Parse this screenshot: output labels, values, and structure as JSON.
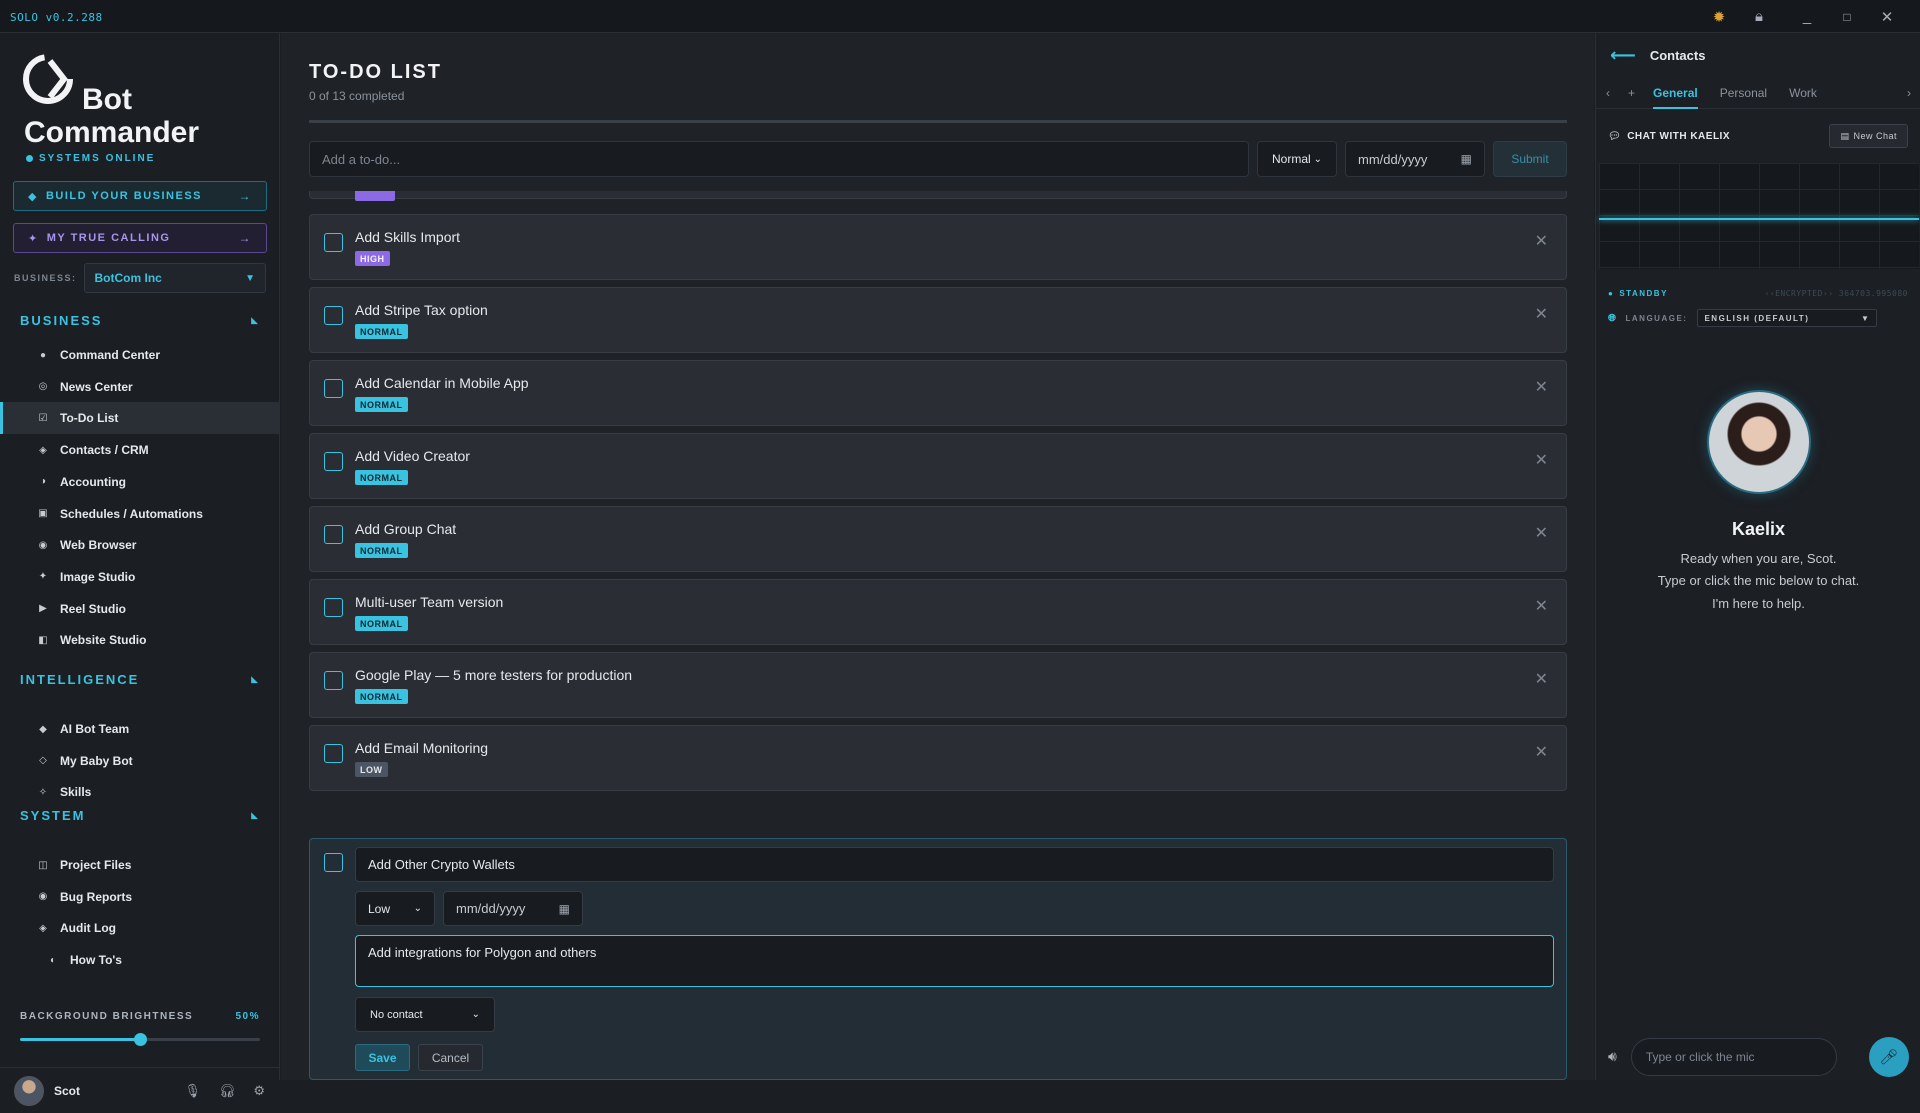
{
  "app": {
    "version": "SOLO  v0.2.288"
  },
  "brand": {
    "line1": "Bot",
    "line2": "Commander",
    "status": "SYSTEMS ONLINE"
  },
  "sidebar": {
    "build_btn": "BUILD YOUR BUSINESS",
    "calling_btn": "MY TRUE CALLING",
    "arrow": "→",
    "business_label": "BUSINESS:",
    "business_value": "BotCom Inc",
    "sections": {
      "business": "BUSINESS",
      "intelligence": "INTELLIGENCE",
      "system": "SYSTEM"
    },
    "business_items": [
      "Command Center",
      "News Center",
      "To-Do List",
      "Contacts / CRM",
      "Accounting",
      "Schedules / Automations",
      "Web Browser",
      "Image Studio",
      "Reel Studio",
      "Website Studio"
    ],
    "intelligence_items": [
      "AI Bot Team",
      "My Baby Bot",
      "Skills"
    ],
    "system_items": [
      "Project Files",
      "Bug Reports",
      "Audit Log"
    ],
    "howto": "How To's",
    "brightness_label": "BACKGROUND BRIGHTNESS",
    "brightness_pct": "50%",
    "brightness_value": 0.5,
    "user": "Scot"
  },
  "todo": {
    "title": "TO-DO LIST",
    "subtitle": "0 of 13 completed",
    "progress": 0,
    "add_placeholder": "Add a to-do...",
    "priority": "Normal",
    "date_placeholder": "mm/dd/yyyy",
    "submit": "Submit",
    "items": [
      {
        "text": "Add Skills Import",
        "tag": "HIGH",
        "cls": "high"
      },
      {
        "text": "Add Stripe Tax option",
        "tag": "NORMAL",
        "cls": "normal"
      },
      {
        "text": "Add Calendar in Mobile App",
        "tag": "NORMAL",
        "cls": "normal"
      },
      {
        "text": "Add Video Creator",
        "tag": "NORMAL",
        "cls": "normal"
      },
      {
        "text": "Add Group Chat",
        "tag": "NORMAL",
        "cls": "normal"
      },
      {
        "text": "Multi-user Team version",
        "tag": "NORMAL",
        "cls": "normal"
      },
      {
        "text": "Google Play — 5 more testers for production",
        "tag": "NORMAL",
        "cls": "normal"
      },
      {
        "text": "Add Email Monitoring",
        "tag": "LOW",
        "cls": "low"
      }
    ],
    "edit": {
      "title": "Add Other Crypto Wallets",
      "priority": "Low",
      "date": "mm/dd/yyyy",
      "notes": "Add integrations for Polygon and others",
      "contact": "No contact",
      "save": "Save",
      "cancel": "Cancel"
    }
  },
  "panel": {
    "title": "Contacts",
    "tabs": [
      "General",
      "Personal",
      "Work"
    ],
    "chat_title": "CHAT WITH KAELIX",
    "new_chat": "New Chat",
    "standby": "STANDBY",
    "encrypted": "‹‹ENCRYPTED›› 364703.995080",
    "language_label": "LANGUAGE:",
    "language_value": "ENGLISH (DEFAULT)",
    "name": "Kaelix",
    "msg1": "Ready when you are, Scot.",
    "msg2": "Type or click the mic below to chat.",
    "msg3": "I'm here to help.",
    "input_placeholder": "Type or click the mic"
  }
}
